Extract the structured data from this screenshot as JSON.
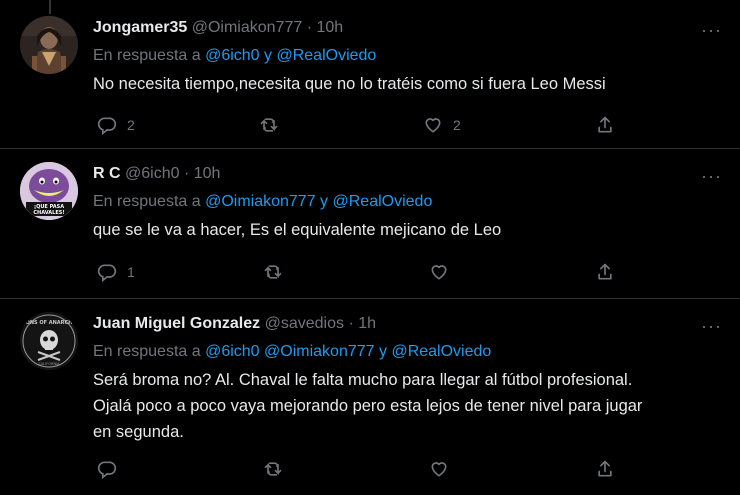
{
  "tweets": [
    {
      "name": "Jongamer35",
      "handle": "@Oimiakon777",
      "time": "10h",
      "reply_prefix": "En respuesta a",
      "mentions": [
        "@6ich0",
        "@RealOviedo"
      ],
      "connector": "y",
      "text": "No necesita tiempo,necesita que no lo tratéis como si fuera Leo Messi",
      "replies": "2",
      "retweets": "",
      "likes": "2",
      "avatar_icon": "person-avatar"
    },
    {
      "name": "R C",
      "handle": "@6ich0",
      "time": "10h",
      "reply_prefix": "En respuesta a",
      "mentions": [
        "@Oimiakon777",
        "@RealOviedo"
      ],
      "connector": "y",
      "text": "que se le va a hacer, Es el equivalente mejicano de Leo",
      "replies": "1",
      "retweets": "",
      "likes": "",
      "avatar_text": "¡QUE PASA CHAVALES!",
      "avatar_icon": "barney-avatar"
    },
    {
      "name": "Juan Miguel Gonzalez",
      "handle": "@savedios",
      "time": "1h",
      "reply_prefix": "En respuesta a",
      "mentions": [
        "@6ich0",
        "@Oimiakon777",
        "@RealOviedo"
      ],
      "connector": "y",
      "text_lines": [
        "Será broma no? Al. Chaval le falta mucho para llegar al fútbol profesional.",
        "Ojalá poco a poco vaya mejorando pero esta lejos de tener nivel para jugar",
        "en segunda."
      ],
      "replies": "",
      "retweets": "",
      "likes": "",
      "avatar_text": "SONS OF ANARCHY",
      "avatar_icon": "sons-of-anarchy-avatar"
    }
  ],
  "separator": "·",
  "more_label": "···",
  "colors": {
    "accent": "#1d9bf0",
    "muted": "#71767b",
    "text": "#e7e9ea",
    "bg": "#000000"
  }
}
